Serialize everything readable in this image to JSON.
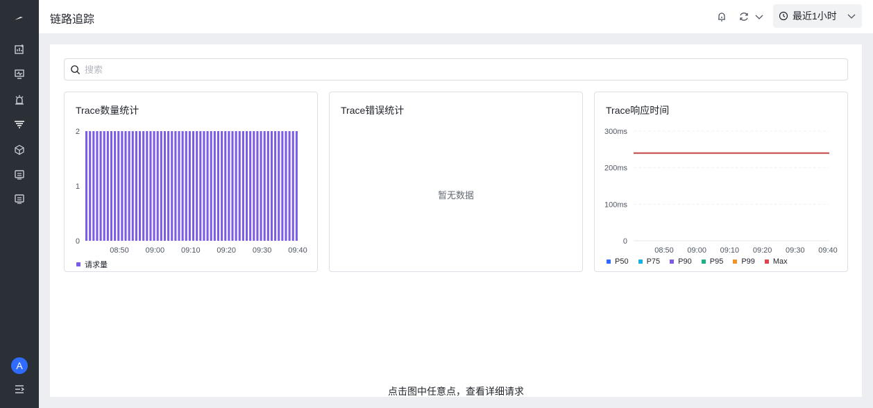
{
  "header": {
    "title": "链路追踪",
    "time_range": "最近1小时"
  },
  "search": {
    "placeholder": "搜索"
  },
  "cards": {
    "count": {
      "title": "Trace数量统计"
    },
    "errors": {
      "title": "Trace错误统计",
      "empty": "暂无数据"
    },
    "latency": {
      "title": "Trace响应时间"
    }
  },
  "hint": "点击图中任意点，查看详细请求",
  "user": {
    "avatar_letter": "A"
  },
  "colors": {
    "sidebar": "#2b2f36",
    "accent": "#2f6bff",
    "bar": "#7c5ce4",
    "max_line": "#c05060"
  },
  "chart_data": [
    {
      "type": "bar",
      "title": "Trace数量统计",
      "x_ticks": [
        "08:50",
        "09:00",
        "09:10",
        "09:20",
        "09:30",
        "09:40"
      ],
      "y_ticks": [
        "0",
        "1",
        "2"
      ],
      "ylim": [
        0,
        2
      ],
      "series": [
        {
          "name": "请求量",
          "color": "#7c5ce4",
          "values": [
            2,
            2,
            2,
            2,
            2,
            2,
            2,
            2,
            2,
            2,
            2,
            2,
            2,
            2,
            2,
            2,
            2,
            2,
            2,
            2,
            2,
            2,
            2,
            2,
            2,
            2,
            2,
            2,
            2,
            2,
            2,
            2,
            2,
            2,
            2,
            2,
            2,
            2,
            2,
            2,
            2,
            2,
            2,
            2,
            2,
            2,
            2,
            2,
            2,
            2,
            2,
            2,
            2,
            2,
            2,
            2,
            2,
            2,
            2,
            2
          ]
        }
      ],
      "grid": false
    },
    {
      "type": "line",
      "title": "Trace错误统计",
      "empty": true
    },
    {
      "type": "line",
      "title": "Trace响应时间",
      "x_ticks": [
        "08:50",
        "09:00",
        "09:10",
        "09:20",
        "09:30",
        "09:40"
      ],
      "y_ticks": [
        "0",
        "100ms",
        "200ms",
        "300ms"
      ],
      "ylim": [
        0,
        300
      ],
      "series": [
        {
          "name": "P50",
          "color": "#2f6bff",
          "value": 240
        },
        {
          "name": "P75",
          "color": "#17b0e0",
          "value": 240
        },
        {
          "name": "P90",
          "color": "#7c5ce4",
          "value": 240
        },
        {
          "name": "P95",
          "color": "#17b386",
          "value": 240
        },
        {
          "name": "P99",
          "color": "#f0932b",
          "value": 240
        },
        {
          "name": "Max",
          "color": "#e0444f",
          "value": 240
        }
      ],
      "grid": true,
      "legend": "bottom"
    }
  ]
}
